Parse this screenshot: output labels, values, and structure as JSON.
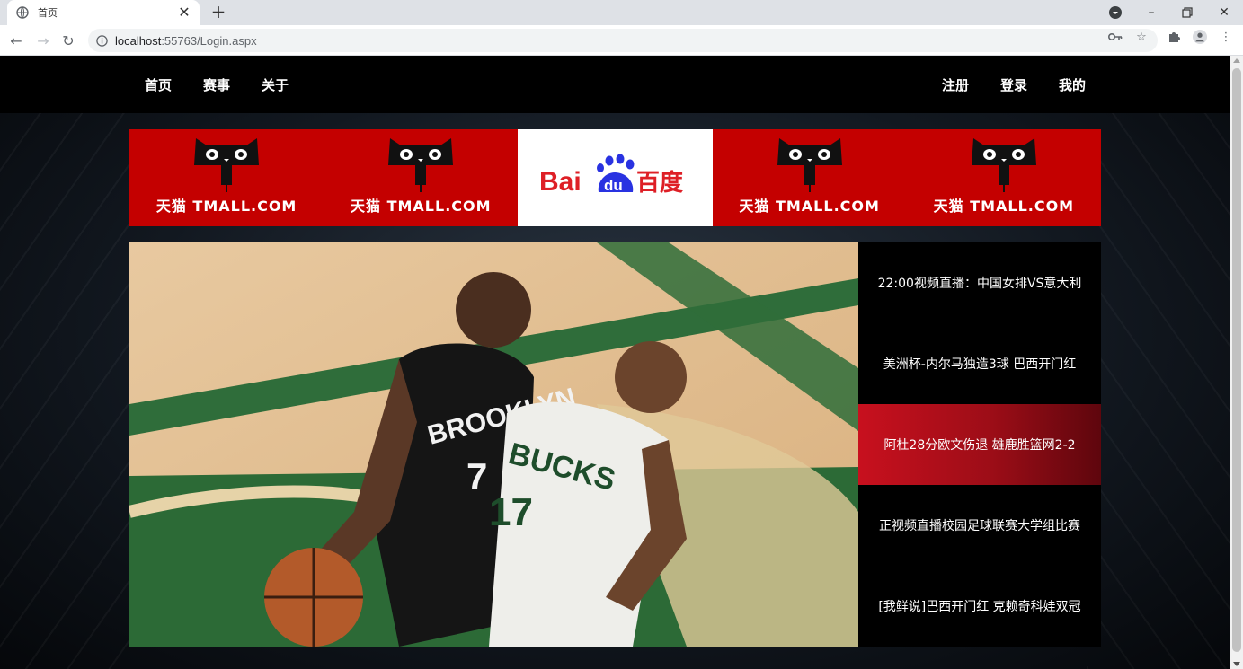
{
  "browser": {
    "tab_title": "首页",
    "url_host": "localhost",
    "url_rest": ":55763/Login.aspx",
    "icons": [
      "globe-icon",
      "close-icon",
      "plus-icon",
      "back-icon",
      "forward-icon",
      "reload-icon",
      "info-icon",
      "key-icon",
      "star-icon",
      "puzzle-icon",
      "profile-icon",
      "kebab-menu-icon",
      "minimize-icon",
      "restore-icon"
    ]
  },
  "nav": {
    "left": [
      "首页",
      "赛事",
      "关于"
    ],
    "right": [
      "注册",
      "登录",
      "我的"
    ]
  },
  "ads": {
    "tmall_text": "天猫 TMALL.COM",
    "baidu_text": "Bai",
    "baidu_du": "du",
    "baidu_cn": "百度",
    "colors": {
      "tmall": "#c40000",
      "baidu_red": "#de1f26",
      "baidu_blue": "#2932e1"
    }
  },
  "hero": {
    "jersey_left": "BROOKLYN",
    "jersey_left_num": "7",
    "jersey_right": "BUCKS",
    "jersey_right_num": "17"
  },
  "news": [
    "22:00视频直播：中国女排VS意大利",
    "美洲杯-内尔马独造3球 巴西开门红",
    "阿杜28分欧文伤退 雄鹿胜篮网2-2",
    "正视频直播校园足球联赛大学组比赛",
    "[我鲜说]巴西开门红 克赖奇科娃双冠"
  ]
}
